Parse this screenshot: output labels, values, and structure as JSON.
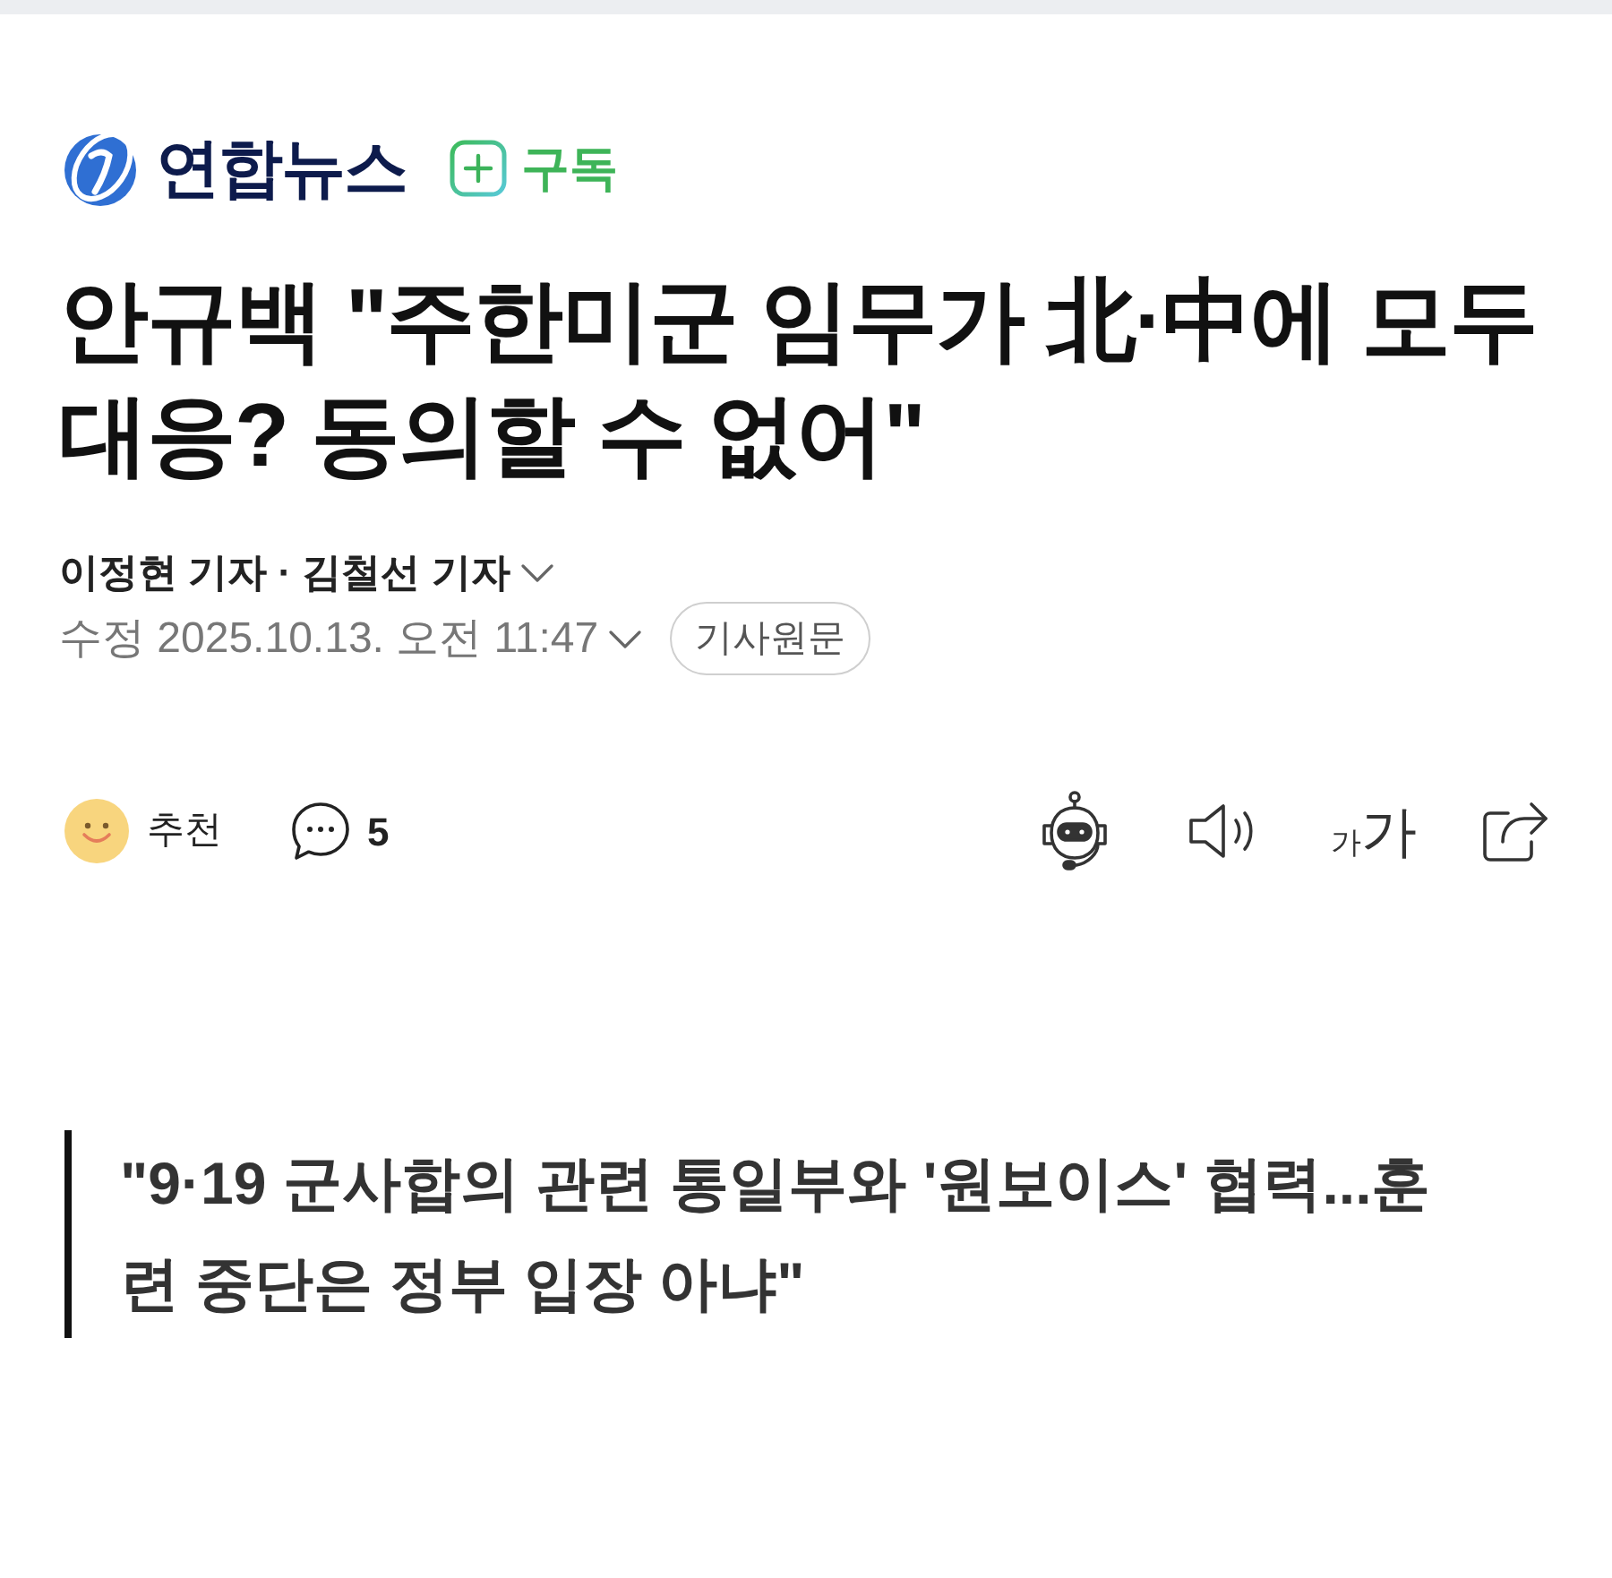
{
  "publisher": {
    "name": "연합뉴스",
    "subscribe_label": "구독"
  },
  "headline": "안규백 \"주한미군 임무가 北·中에 모두 대응? 동의할 수 없어\"",
  "byline": {
    "authors": "이정현 기자 · 김철선 기자",
    "timestamp": "수정 2025.10.13. 오전 11:47",
    "original_button": "기사원문"
  },
  "reactions": {
    "recommend_label": "추천",
    "comment_count": "5"
  },
  "text_size_button": {
    "small": "가",
    "large": "가"
  },
  "subheading": "\"9·19 군사합의 관련 통일부와 '원보이스' 협력...훈련 중단은 정부 입장 아냐\""
}
